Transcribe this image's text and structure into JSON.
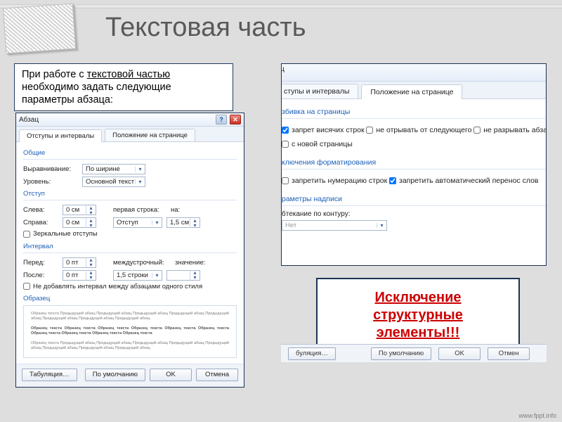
{
  "slide": {
    "title": "Текстовая часть",
    "note_prefix": "При работе с ",
    "note_link": "текстовой частью",
    "note_suffix": " необходимо задать следующие параметры абзаца:",
    "footer": "www.fppt.info"
  },
  "callout": {
    "line1": "Исключение",
    "line2": "структурные",
    "line3": "элементы!!!"
  },
  "dlg": {
    "title": "Абзац",
    "help_icon": "?",
    "close_icon": "✕",
    "tab1": "Отступы и интервалы",
    "tab2": "Положение на странице",
    "g_common": "Общие",
    "alignment_lbl": "Выравнивание:",
    "alignment_val": "По ширине",
    "level_lbl": "Уровень:",
    "level_val": "Основной текст",
    "g_indent": "Отступ",
    "left_lbl": "Слева:",
    "left_val": "0 см",
    "right_lbl": "Справа:",
    "right_val": "0 см",
    "firstline_lbl": "первая строка:",
    "firstline_val": "Отступ",
    "on_lbl": "на:",
    "on_val": "1,5 см",
    "mirror_chk": "Зеркальные отступы",
    "g_interval": "Интервал",
    "before_lbl": "Перед:",
    "before_val": "0 пт",
    "after_lbl": "После:",
    "after_val": "0 пт",
    "linesp_lbl": "междустрочный:",
    "linesp_val": "1,5 строки",
    "value_lbl": "значение:",
    "value_val": "",
    "noaddspace_chk": "Не добавлять интервал между абзацами одного стиля",
    "g_preview": "Образец",
    "preview_text": "Образец текста Предыдущий абзац Предыдущий абзац Предыдущий абзац Предыдущий абзац Предыдущий абзац Предыдущий абзац Предыдущий абзац Предыдущий абзац",
    "preview_text2": "Образец текста Образец текста Образец текста Образец текста Образец текста Образец текста Образец текста Образец текста Образец текста Образец текста",
    "btn_tabs": "Табуляция…",
    "btn_default": "По умолчанию",
    "btn_ok": "OK",
    "btn_cancel": "Отмена"
  },
  "dlg2": {
    "title_partial": "ац",
    "tab1_partial": "ступы и интервалы",
    "tab2": "Положение на странице",
    "g_paging": "збивка на страницы",
    "chk1": "запрет висячих строк",
    "chk2": "не отрывать от следующего",
    "chk3": "не разрывать абзац",
    "chk4": "с новой страницы",
    "g_format": "ключения форматирования",
    "chk5": "запретить нумерацию строк",
    "chk6": "запретить автоматический перенос слов",
    "g_textbox": "раметры надписи",
    "wrap_lbl": "бтекание по контуру:",
    "wrap_val": "Нет",
    "btn_tabs_partial": "буляция…",
    "btn_default": "По умолчанию",
    "btn_ok": "OK",
    "btn_cancel_partial": "Отмен"
  }
}
